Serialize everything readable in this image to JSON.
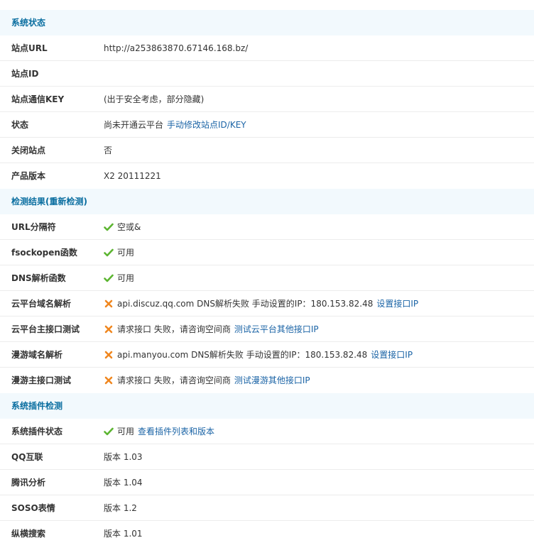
{
  "sections": {
    "system_status": {
      "title": "系统状态",
      "rows": [
        {
          "label": "站点URL",
          "value": "http://a253863870.67146.168.bz/"
        },
        {
          "label": "站点ID",
          "value": ""
        },
        {
          "label": "站点通信KEY",
          "value": "(出于安全考虑，部分隐藏)"
        },
        {
          "label": "状态",
          "value": "尚未开通云平台",
          "link": "手动修改站点ID/KEY"
        },
        {
          "label": "关闭站点",
          "value": "否"
        },
        {
          "label": "产品版本",
          "value": "X2 20111221"
        }
      ]
    },
    "check_results": {
      "title": "检测结果(重新检测)",
      "rows": [
        {
          "label": "URL分隔符",
          "icon": "check-icon",
          "value": "空或&"
        },
        {
          "label": "fsockopen函数",
          "icon": "check-icon",
          "value": "可用"
        },
        {
          "label": "DNS解析函数",
          "icon": "check-icon",
          "value": "可用"
        },
        {
          "label": "云平台域名解析",
          "icon": "cross-icon",
          "value": "api.discuz.qq.com DNS解析失败 手动设置的IP：180.153.82.48",
          "link": "设置接口IP"
        },
        {
          "label": "云平台主接口测试",
          "icon": "cross-icon",
          "value": "请求接口 失败，请咨询空间商",
          "link": "测试云平台其他接口IP"
        },
        {
          "label": "漫游域名解析",
          "icon": "cross-icon",
          "value": "api.manyou.com DNS解析失败 手动设置的IP：180.153.82.48",
          "link": "设置接口IP"
        },
        {
          "label": "漫游主接口测试",
          "icon": "cross-icon",
          "value": "请求接口 失败，请咨询空间商",
          "link": "测试漫游其他接口IP"
        }
      ]
    },
    "plugin_check": {
      "title": "系统插件检测",
      "rows": [
        {
          "label": "系统插件状态",
          "icon": "check-icon",
          "value": "可用",
          "link": "查看插件列表和版本"
        },
        {
          "label": "QQ互联",
          "value": "版本 1.03"
        },
        {
          "label": "腾讯分析",
          "value": "版本 1.04"
        },
        {
          "label": "SOSO表情",
          "value": "版本 1.2"
        },
        {
          "label": "纵横搜索",
          "value": "版本 1.01"
        }
      ]
    }
  },
  "colors": {
    "section_bg": "#f2f9fd",
    "section_title": "#0a6ea0",
    "link": "#1b64a6",
    "check": "#5cb531",
    "cross": "#f0871f"
  }
}
